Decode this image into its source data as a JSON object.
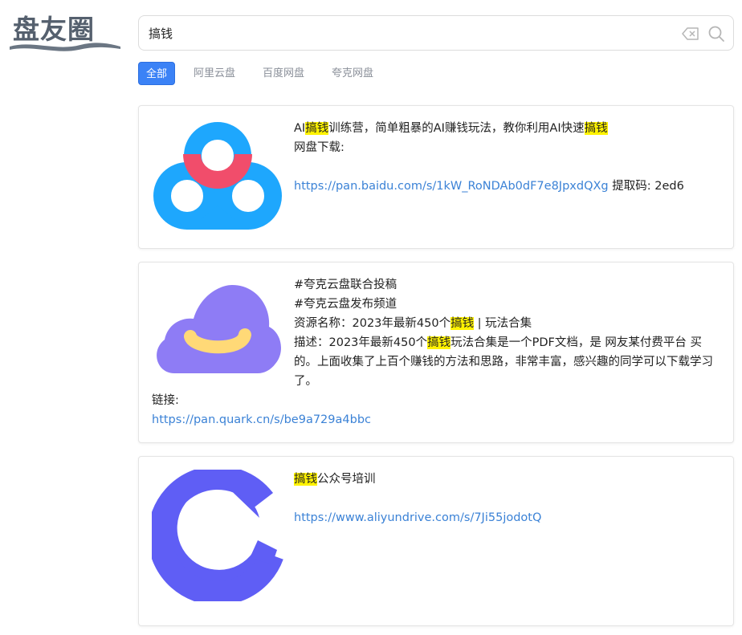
{
  "logo": {
    "text": "盘友圈"
  },
  "search": {
    "query": "搞钱"
  },
  "tabs": [
    {
      "label": "全部",
      "active": true
    },
    {
      "label": "阿里云盘",
      "active": false
    },
    {
      "label": "百度网盘",
      "active": false
    },
    {
      "label": "夸克网盘",
      "active": false
    }
  ],
  "colors": {
    "accent": "#3b82f6",
    "highlight": "#fff200",
    "link": "#3b82d6"
  },
  "results": [
    {
      "icon": "baidu-netdisk-icon",
      "title_pre": "AI",
      "title_hl1": "搞钱",
      "title_mid": "训练营，简单粗暴的AI赚钱玩法，教你利用AI快速",
      "title_hl2": "搞钱",
      "label": "网盘下载:",
      "link": "https://pan.baidu.com/s/1kW_RoNDAb0dF7e8JpxdQXg",
      "code": " 提取码: 2ed6"
    },
    {
      "icon": "quark-cloud-icon",
      "line1": "#夸克云盘联合投稿",
      "line2": "#夸克云盘发布频道",
      "line3_pre": "资源名称：2023年最新450个",
      "line3_hl": "搞钱",
      "line3_post": " | 玩法合集",
      "desc_pre": "描述：2023年最新450个",
      "desc_hl": "搞钱",
      "desc_post": "玩法合集是一个PDF文档，是 网友某付费平台 买的。上面收集了上百个赚钱的方法和思路，非常丰富，感兴趣的同学可以下载学习了。",
      "link_label": "链接:",
      "link": "https://pan.quark.cn/s/be9a729a4bbc"
    },
    {
      "icon": "aliyundrive-icon",
      "title_hl": "搞钱",
      "title_post": "公众号培训",
      "link": "https://www.aliyundrive.com/s/7Ji55jodotQ"
    }
  ]
}
